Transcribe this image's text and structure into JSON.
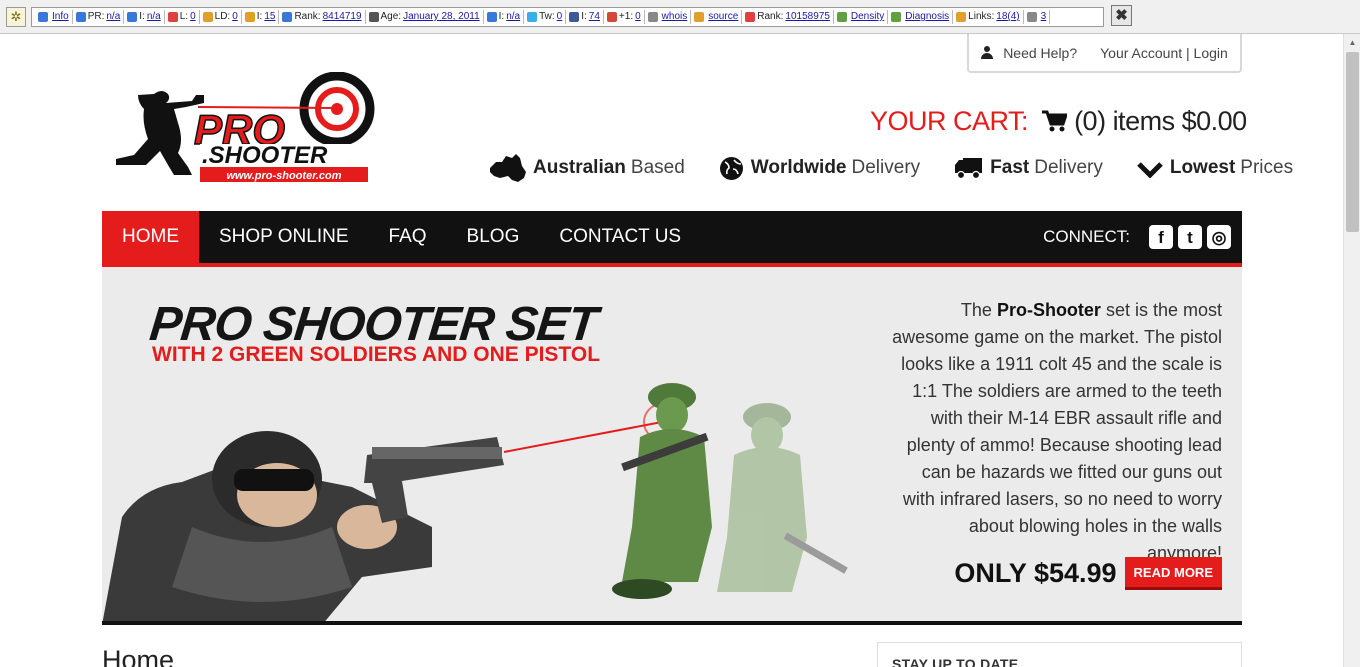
{
  "toolbar": {
    "items": [
      {
        "prefix": "",
        "link": "Info",
        "color": "#3a78d8"
      },
      {
        "prefix": "PR:",
        "link": "n/a",
        "color": "#3a78d8"
      },
      {
        "prefix": "I:",
        "link": "n/a",
        "color": "#3a78d8"
      },
      {
        "prefix": "L:",
        "link": "0",
        "color": "#e04040"
      },
      {
        "prefix": "LD:",
        "link": "0",
        "color": "#e0a030"
      },
      {
        "prefix": "I:",
        "link": "15",
        "color": "#e0a020"
      },
      {
        "prefix": "Rank:",
        "link": "8414719",
        "color": "#3a78d8"
      },
      {
        "prefix": "Age:",
        "link": "January 28, 2011",
        "color": "#555555"
      },
      {
        "prefix": "I:",
        "link": "n/a",
        "color": "#3a78d8"
      },
      {
        "prefix": "Tw:",
        "link": "0",
        "color": "#3aaee8"
      },
      {
        "prefix": "I:",
        "link": "74",
        "color": "#3b5998"
      },
      {
        "prefix": "+1:",
        "link": "0",
        "color": "#d34836"
      },
      {
        "prefix": "",
        "link": "whois",
        "color": "#888888"
      },
      {
        "prefix": "",
        "link": "source",
        "color": "#e0a030"
      },
      {
        "prefix": "Rank:",
        "link": "10158975",
        "color": "#e04040"
      },
      {
        "prefix": "",
        "link": "Density",
        "color": "#60a040"
      },
      {
        "prefix": "",
        "link": "Diagnosis",
        "color": "#60a040"
      },
      {
        "prefix": "Links:",
        "link": "18(4)",
        "color": "#e0a030"
      },
      {
        "prefix": "",
        "link": "3",
        "color": "#888888"
      }
    ],
    "close_glyph": "✖"
  },
  "header": {
    "need_help": "Need Help?",
    "account_login": "Your Account | Login",
    "logo_text": "PRO SHOOTER",
    "logo_url": "www.pro-shooter.com",
    "cart_label": "YOUR CART:",
    "cart_count": "(0) items $0.00",
    "features": [
      {
        "icon": "australia-icon",
        "bold": "Australian",
        "light": "Based"
      },
      {
        "icon": "globe-icon",
        "bold": "Worldwide",
        "light": "Delivery"
      },
      {
        "icon": "truck-icon",
        "bold": "Fast",
        "light": "Delivery"
      },
      {
        "icon": "checkmark-icon",
        "bold": "Lowest",
        "light": "Prices"
      }
    ]
  },
  "nav": {
    "items": [
      "HOME",
      "SHOP ONLINE",
      "FAQ",
      "BLOG",
      "CONTACT US"
    ],
    "active": "HOME",
    "connect_label": "CONNECT:",
    "social": [
      "f",
      "t",
      "◎"
    ]
  },
  "hero": {
    "title": "PRO SHOOTER SET",
    "subtitle": "WITH 2 GREEN SOLDIERS AND ONE PISTOL",
    "text_pre": "The ",
    "text_bold": "Pro-Shooter",
    "text_post": " set is the most awesome game on the market. The pistol looks like a 1911 colt 45 and the scale is 1:1 The soldiers are armed to the teeth with their M-14 EBR assault rifle and plenty of ammo! Because shooting lead can be hazards we fitted our guns out with infrared lasers, so no need to worry about blowing holes in the walls anymore!",
    "price": "ONLY $54.99",
    "read_more": "READ MORE"
  },
  "content": {
    "heading": "Home",
    "sidebar_title": "STAY UP TO DATE"
  },
  "colors": {
    "brand_red": "#e41c1c",
    "nav_bg": "#111111"
  }
}
